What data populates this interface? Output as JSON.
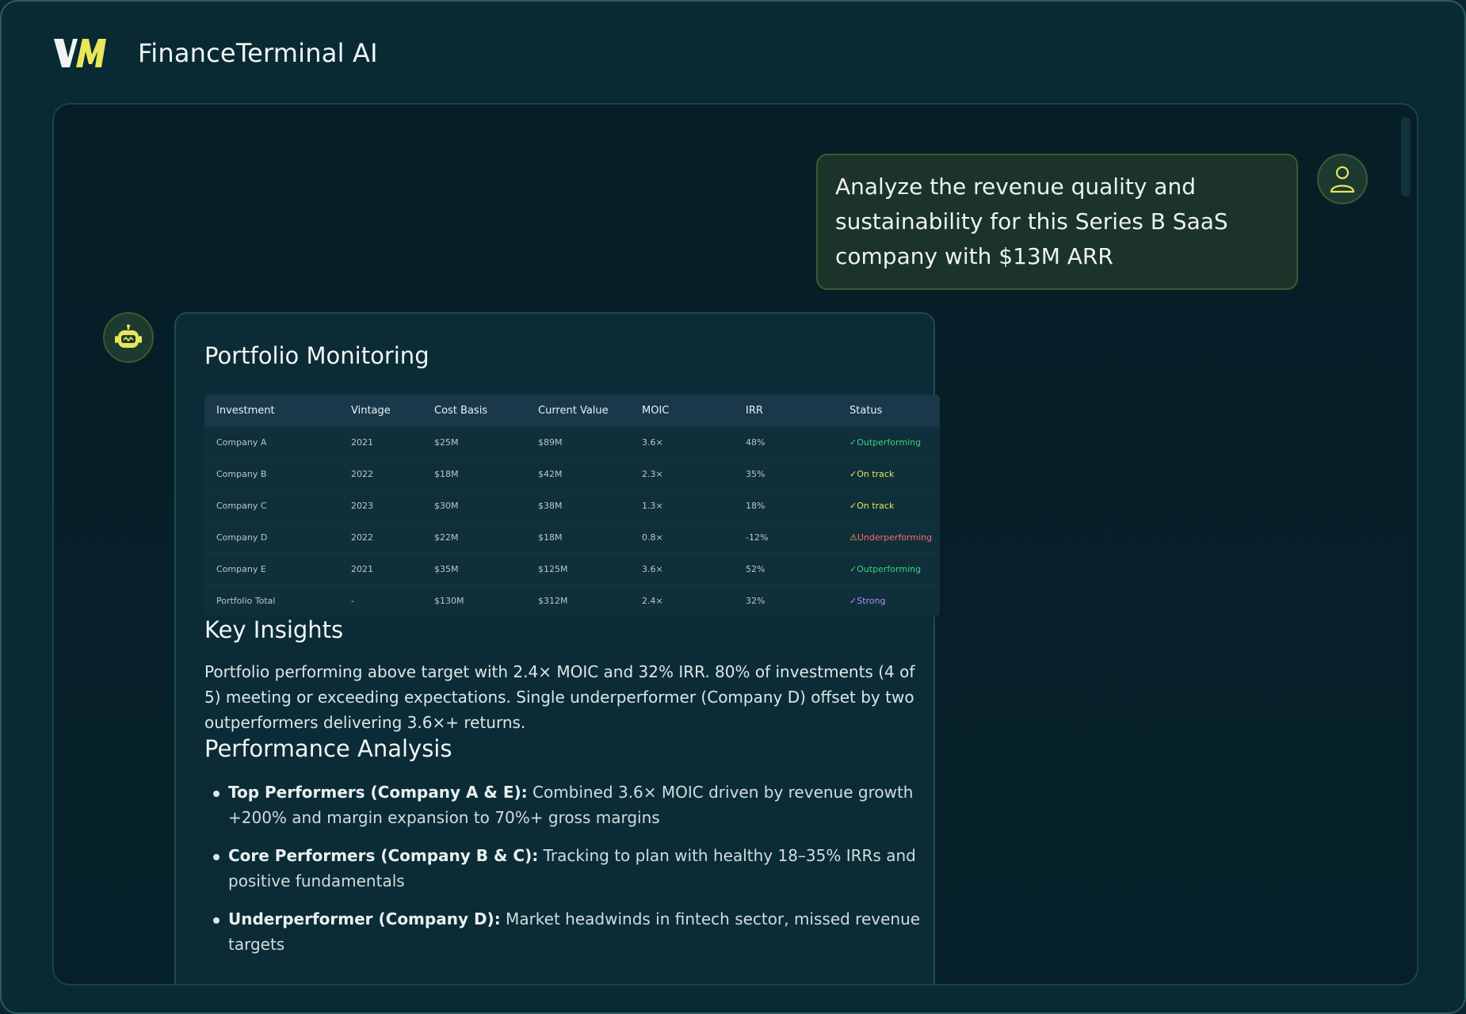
{
  "app": {
    "title": "FinanceTerminal AI",
    "logo_text": "VM"
  },
  "user_message": {
    "text": "Analyze the revenue quality and sustainability for this Series B SaaS company with $13M ARR"
  },
  "response": {
    "portfolio_title": "Portfolio Monitoring",
    "table": {
      "headers": [
        "Investment",
        "Vintage",
        "Cost Basis",
        "Current Value",
        "MOIC",
        "IRR",
        "Status"
      ],
      "rows": [
        {
          "investment": "Company A",
          "vintage": "2021",
          "cost": "$25M",
          "value": "$89M",
          "moic": "3.6×",
          "irr": "48%",
          "status_glyph": "✓",
          "status": "Outperforming",
          "status_color": "#3ed17b"
        },
        {
          "investment": "Company B",
          "vintage": "2022",
          "cost": "$18M",
          "value": "$42M",
          "moic": "2.3×",
          "irr": "35%",
          "status_glyph": "✓",
          "status": "On track",
          "status_color": "#e8e65a"
        },
        {
          "investment": "Company C",
          "vintage": "2023",
          "cost": "$30M",
          "value": "$38M",
          "moic": "1.3×",
          "irr": "18%",
          "status_glyph": "✓",
          "status": "On track",
          "status_color": "#e8e65a"
        },
        {
          "investment": "Company D",
          "vintage": "2022",
          "cost": "$22M",
          "value": "$18M",
          "moic": "0.8×",
          "irr": "-12%",
          "status_glyph": "⚠",
          "status": "Underperforming",
          "status_color": "#ff6b6b"
        },
        {
          "investment": "Company E",
          "vintage": "2021",
          "cost": "$35M",
          "value": "$125M",
          "moic": "3.6×",
          "irr": "52%",
          "status_glyph": "✓",
          "status": "Outperforming",
          "status_color": "#3ed17b"
        },
        {
          "investment": "Portfolio Total",
          "vintage": "-",
          "cost": "$130M",
          "value": "$312M",
          "moic": "2.4×",
          "irr": "32%",
          "status_glyph": "✓",
          "status": "Strong",
          "status_color": "#b48cff"
        }
      ]
    },
    "insights_title": "Key Insights",
    "insights_text": "Portfolio performing above target with 2.4× MOIC and 32% IRR. 80% of investments (4 of 5) meeting or exceeding expectations. Single underperformer (Company D) offset by two outperformers delivering 3.6×+ returns.",
    "performance_title": "Performance Analysis",
    "performance_points": [
      {
        "lead": "Top Performers (Company A & E):",
        "text": " Combined 3.6× MOIC driven by revenue growth +200% and margin expansion to 70%+ gross margins"
      },
      {
        "lead": "Core Performers (Company B & C):",
        "text": " Tracking to plan with healthy 18–35% IRRs and positive fundamentals"
      },
      {
        "lead": "Underperformer (Company D):",
        "text": " Market headwinds in fintech sector, missed revenue targets"
      }
    ]
  },
  "colors": {
    "accent": "#e8e65a",
    "background": "#0a2a33",
    "user_bubble": "#1b3328"
  }
}
